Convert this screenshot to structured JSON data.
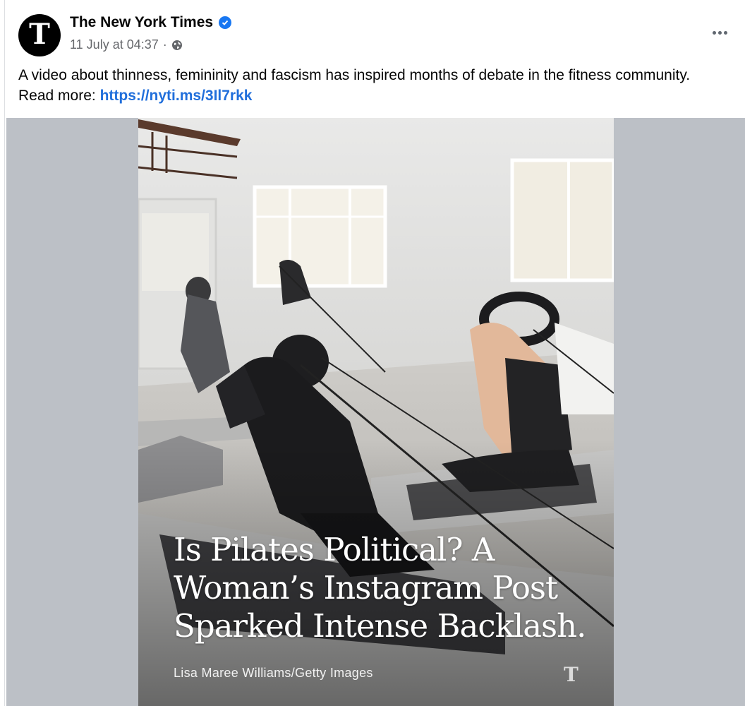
{
  "post": {
    "author": "The New York Times",
    "verified_icon": "verified-badge-icon",
    "timestamp": "11 July at 04:37",
    "separator": "·",
    "audience_icon": "globe-icon",
    "more_icon": "more-horizontal-icon",
    "avatar_glyph": "T",
    "body_text": "A video about thinness, femininity and fascism has inspired months of debate in the fitness community. Read more: ",
    "link_text": "https://nyti.ms/3Il7rkk"
  },
  "image": {
    "headline": "Is Pilates Political? A Woman’s Instagram Post Sparked Intense Backlash.",
    "credit": "Lisa Maree Williams/Getty Images",
    "watermark_glyph": "T"
  },
  "colors": {
    "link": "#216fdb",
    "verified": "#1877f2",
    "media_background": "#bcc0c6"
  }
}
